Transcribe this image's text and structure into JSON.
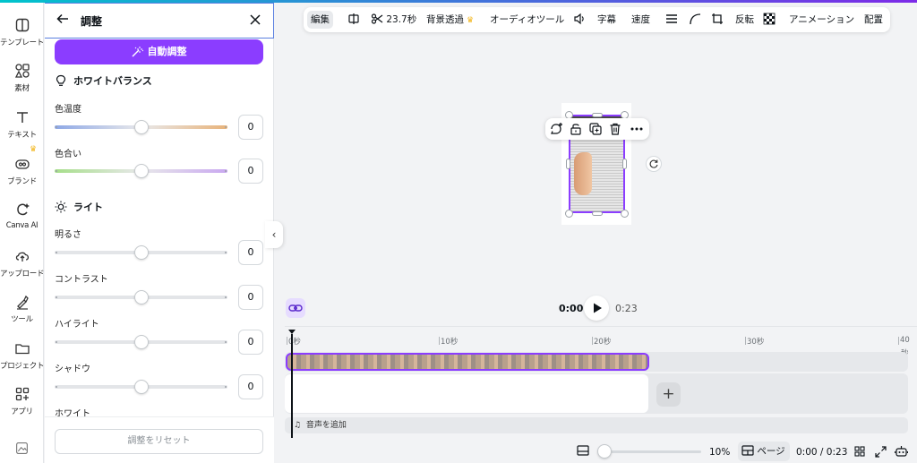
{
  "colors": {
    "accent": "#8b3dff",
    "crown": "#f2b519",
    "panel_border": "#5a7fe0"
  },
  "rail": {
    "items": [
      {
        "label": "テンプレート",
        "icon": "template-icon"
      },
      {
        "label": "素材",
        "icon": "elements-icon"
      },
      {
        "label": "テキスト",
        "icon": "text-icon"
      },
      {
        "label": "ブランド",
        "icon": "brand-icon"
      },
      {
        "label": "Canva AI",
        "icon": "canva-ai-icon"
      },
      {
        "label": "アップロード",
        "icon": "upload-icon"
      },
      {
        "label": "ツール",
        "icon": "tools-icon"
      },
      {
        "label": "プロジェクト",
        "icon": "folder-icon"
      },
      {
        "label": "アプリ",
        "icon": "apps-icon"
      }
    ]
  },
  "panel": {
    "title": "調整",
    "auto_label": "自動調整",
    "sections": {
      "white_balance": "ホワイトバランス",
      "light": "ライト"
    },
    "sliders": [
      {
        "label": "色温度",
        "value": "0",
        "level": 0.5
      },
      {
        "label": "色合い",
        "value": "0",
        "level": 0.5
      },
      {
        "label": "明るさ",
        "value": "0",
        "level": 0.5
      },
      {
        "label": "コントラスト",
        "value": "0",
        "level": 0.5
      },
      {
        "label": "ハイライト",
        "value": "0",
        "level": 0.5
      },
      {
        "label": "シャドウ",
        "value": "0",
        "level": 0.5
      }
    ],
    "next_label": "ホワイト",
    "reset_label": "調整をリセット"
  },
  "toolbar": {
    "edit": "編集",
    "duration": "23.7秒",
    "bg_remove": "背景透過",
    "audio_tools": "オーディオツール",
    "captions": "字幕",
    "speed": "速度",
    "flip": "反転",
    "animation": "アニメーション",
    "position": "配置"
  },
  "player": {
    "current": "0:00",
    "total": "0:23"
  },
  "timeline": {
    "ticks": [
      "0秒",
      "10秒",
      "20秒",
      "30秒",
      "40",
      "秒"
    ],
    "add_audio": "音声を追加"
  },
  "footer": {
    "zoom": "10%",
    "zoom_level": 0.1,
    "pages_label": "ページ",
    "time": "0:00 / 0:23"
  }
}
